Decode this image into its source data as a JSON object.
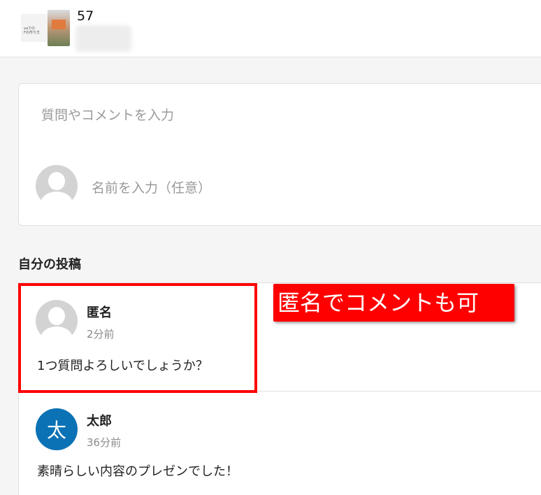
{
  "header": {
    "thumbnail_text": "vaでの\nFの作り方",
    "count": "57"
  },
  "composer": {
    "comment_placeholder": "質問やコメントを入力",
    "name_placeholder": "名前を入力（任意）"
  },
  "my_posts": {
    "title": "自分の投稿"
  },
  "comments": [
    {
      "name": "匿名",
      "time": "2分前",
      "text": "1つ質問よろしいでしょうか？",
      "avatar": "default-avatar-icon"
    },
    {
      "name": "太郎",
      "time": "36分前",
      "text": "素晴らしい内容のプレゼンでした！",
      "avatar_letter": "太",
      "avatar_color": "#0b72b5"
    }
  ],
  "annotation": {
    "callout": "匿名でコメントも可",
    "color": "#ff0000"
  }
}
